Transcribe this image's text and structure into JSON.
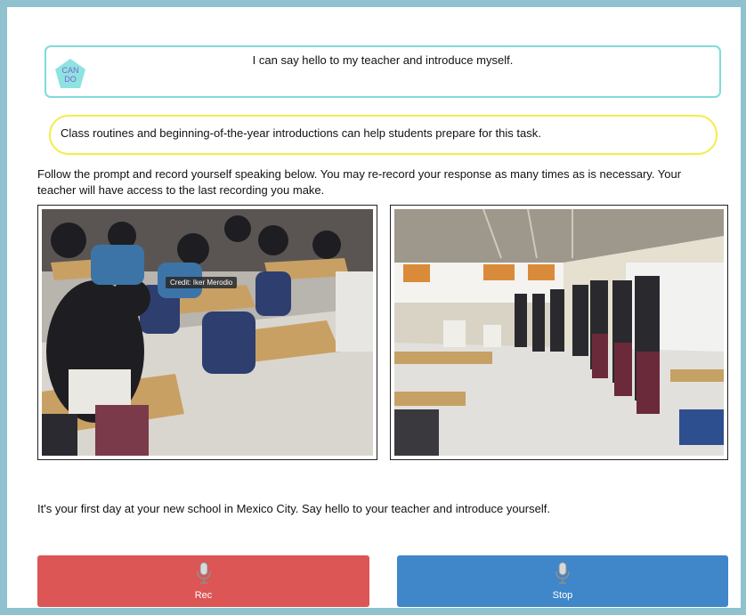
{
  "cando": {
    "badge_text": "CAN DO",
    "statement": "I can say hello to my teacher and introduce myself."
  },
  "hint": {
    "text": "Class routines and beginning-of-the-year introductions can help students prepare for this task."
  },
  "instructions": "Follow the prompt and record yourself speaking below. You may re-record your response as many times as is necessary. Your teacher will have access to the last recording you make.",
  "photos": {
    "left_credit": "Credit: Iker Merodio"
  },
  "prompt": "It's your first day at your new school in Mexico City. Say hello to your teacher and introduce yourself.",
  "buttons": {
    "rec_label": "Rec",
    "stop_label": "Stop",
    "rec_color": "#db5654",
    "stop_color": "#3f87c9",
    "icon": "microphone-icon"
  },
  "colors": {
    "frame": "#8fc1cf",
    "cando_border": "#7fdcd9",
    "hint_border": "#f1ee4a"
  }
}
